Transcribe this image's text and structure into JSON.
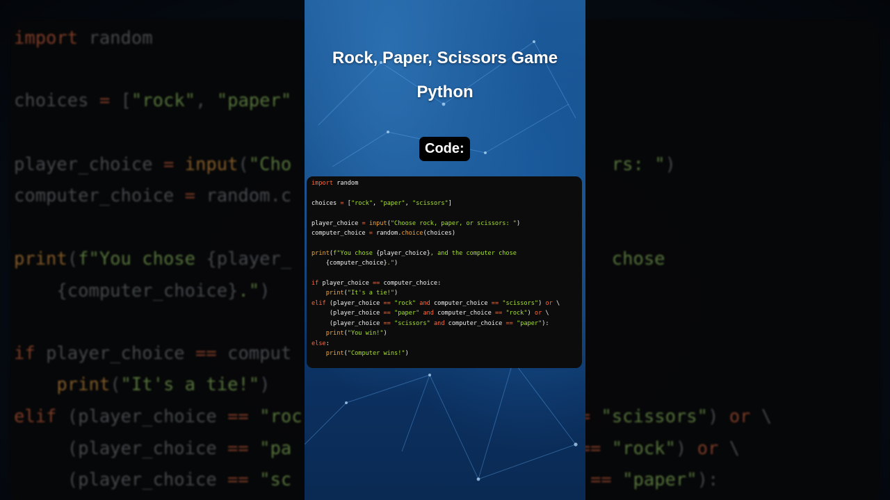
{
  "title_line1": "Rock, Paper, Scissors Game",
  "title_line2": "Python",
  "code_label": "Code:",
  "code_lines": [
    [
      {
        "t": "import",
        "c": "k"
      },
      {
        "t": " random"
      }
    ],
    [],
    [
      {
        "t": "choices "
      },
      {
        "t": "=",
        "c": "o"
      },
      {
        "t": " ["
      },
      {
        "t": "\"rock\"",
        "c": "s"
      },
      {
        "t": ", "
      },
      {
        "t": "\"paper\"",
        "c": "s"
      },
      {
        "t": ", "
      },
      {
        "t": "\"scissors\"",
        "c": "s"
      },
      {
        "t": "]"
      }
    ],
    [],
    [
      {
        "t": "player_choice "
      },
      {
        "t": "=",
        "c": "o"
      },
      {
        "t": " "
      },
      {
        "t": "input",
        "c": "f"
      },
      {
        "t": "("
      },
      {
        "t": "\"Choose rock, paper, or scissors: \"",
        "c": "s"
      },
      {
        "t": ")"
      }
    ],
    [
      {
        "t": "computer_choice "
      },
      {
        "t": "=",
        "c": "o"
      },
      {
        "t": " random."
      },
      {
        "t": "choice",
        "c": "f"
      },
      {
        "t": "(choices)"
      }
    ],
    [],
    [
      {
        "t": "print",
        "c": "f"
      },
      {
        "t": "("
      },
      {
        "t": "f\"You chose ",
        "c": "s"
      },
      {
        "t": "{player_choice}"
      },
      {
        "t": ", and the computer chose",
        "c": "s"
      }
    ],
    [
      {
        "t": "    {computer_choice}"
      },
      {
        "t": ".\"",
        "c": "s"
      },
      {
        "t": ")"
      }
    ],
    [],
    [
      {
        "t": "if",
        "c": "k"
      },
      {
        "t": " player_choice "
      },
      {
        "t": "==",
        "c": "o"
      },
      {
        "t": " computer_choice:"
      }
    ],
    [
      {
        "t": "    "
      },
      {
        "t": "print",
        "c": "f"
      },
      {
        "t": "("
      },
      {
        "t": "\"It's a tie!\"",
        "c": "s"
      },
      {
        "t": ")"
      }
    ],
    [
      {
        "t": "elif",
        "c": "k"
      },
      {
        "t": " (player_choice "
      },
      {
        "t": "==",
        "c": "o"
      },
      {
        "t": " "
      },
      {
        "t": "\"rock\"",
        "c": "s"
      },
      {
        "t": " "
      },
      {
        "t": "and",
        "c": "k"
      },
      {
        "t": " computer_choice "
      },
      {
        "t": "==",
        "c": "o"
      },
      {
        "t": " "
      },
      {
        "t": "\"scissors\"",
        "c": "s"
      },
      {
        "t": ") "
      },
      {
        "t": "or",
        "c": "k"
      },
      {
        "t": " \\"
      }
    ],
    [
      {
        "t": "     (player_choice "
      },
      {
        "t": "==",
        "c": "o"
      },
      {
        "t": " "
      },
      {
        "t": "\"paper\"",
        "c": "s"
      },
      {
        "t": " "
      },
      {
        "t": "and",
        "c": "k"
      },
      {
        "t": " computer_choice "
      },
      {
        "t": "==",
        "c": "o"
      },
      {
        "t": " "
      },
      {
        "t": "\"rock\"",
        "c": "s"
      },
      {
        "t": ") "
      },
      {
        "t": "or",
        "c": "k"
      },
      {
        "t": " \\"
      }
    ],
    [
      {
        "t": "     (player_choice "
      },
      {
        "t": "==",
        "c": "o"
      },
      {
        "t": " "
      },
      {
        "t": "\"scissors\"",
        "c": "s"
      },
      {
        "t": " "
      },
      {
        "t": "and",
        "c": "k"
      },
      {
        "t": " computer_choice "
      },
      {
        "t": "==",
        "c": "o"
      },
      {
        "t": " "
      },
      {
        "t": "\"paper\"",
        "c": "s"
      },
      {
        "t": "):"
      }
    ],
    [
      {
        "t": "    "
      },
      {
        "t": "print",
        "c": "f"
      },
      {
        "t": "("
      },
      {
        "t": "\"You win!\"",
        "c": "s"
      },
      {
        "t": ")"
      }
    ],
    [
      {
        "t": "else",
        "c": "k"
      },
      {
        "t": ":"
      }
    ],
    [
      {
        "t": "    "
      },
      {
        "t": "print",
        "c": "f"
      },
      {
        "t": "("
      },
      {
        "t": "\"Computer wins!\"",
        "c": "s"
      },
      {
        "t": ")"
      }
    ]
  ],
  "bg_lines": [
    [
      {
        "t": "import",
        "c": "bk"
      },
      {
        "t": " random"
      }
    ],
    [
      {
        "t": "choices "
      },
      {
        "t": "=",
        "c": "bk"
      },
      {
        "t": " ["
      },
      {
        "t": "\"rock\"",
        "c": "bs"
      },
      {
        "t": ", "
      },
      {
        "t": "\"paper\"",
        "c": "bs"
      },
      {
        "t": "                             "
      }
    ],
    [
      {
        "t": "player_choice "
      },
      {
        "t": "=",
        "c": "bk"
      },
      {
        "t": " "
      },
      {
        "t": "input",
        "c": "bf"
      },
      {
        "t": "("
      },
      {
        "t": "\"Cho",
        "c": "bs"
      },
      {
        "t": "                              "
      },
      {
        "t": "rs: \"",
        "c": "bs"
      },
      {
        "t": ")"
      }
    ],
    [
      {
        "t": "computer_choice "
      },
      {
        "t": "=",
        "c": "bk"
      },
      {
        "t": " random.c"
      }
    ],
    [
      {
        "t": "print",
        "c": "bf"
      },
      {
        "t": "("
      },
      {
        "t": "f\"You chose ",
        "c": "bs"
      },
      {
        "t": "{player_"
      },
      {
        "t": "                              "
      },
      {
        "t": "chose",
        "c": "bs"
      }
    ],
    [
      {
        "t": "    {computer_choice}"
      },
      {
        "t": ".\"",
        "c": "bs"
      },
      {
        "t": ")"
      }
    ],
    [
      {
        "t": "if",
        "c": "bk"
      },
      {
        "t": " player_choice "
      },
      {
        "t": "==",
        "c": "bk"
      },
      {
        "t": " comput"
      }
    ],
    [
      {
        "t": "    "
      },
      {
        "t": "print",
        "c": "bf"
      },
      {
        "t": "("
      },
      {
        "t": "\"It's a tie!\"",
        "c": "bs"
      },
      {
        "t": ")"
      }
    ],
    [
      {
        "t": "elif",
        "c": "bk"
      },
      {
        "t": " (player_choice "
      },
      {
        "t": "==",
        "c": "bk"
      },
      {
        "t": " "
      },
      {
        "t": "\"roc",
        "c": "bs"
      },
      {
        "t": "                          "
      },
      {
        "t": "= ",
        "c": "bk"
      },
      {
        "t": "\"scissors\"",
        "c": "bs"
      },
      {
        "t": ") "
      },
      {
        "t": "or",
        "c": "bk"
      },
      {
        "t": " \\"
      }
    ],
    [
      {
        "t": "     (player_choice "
      },
      {
        "t": "==",
        "c": "bk"
      },
      {
        "t": " "
      },
      {
        "t": "\"pa",
        "c": "bs"
      },
      {
        "t": "                           "
      },
      {
        "t": "== ",
        "c": "bk"
      },
      {
        "t": "\"rock\"",
        "c": "bs"
      },
      {
        "t": ") "
      },
      {
        "t": "or",
        "c": "bk"
      },
      {
        "t": " \\"
      }
    ],
    [
      {
        "t": "     (player_choice "
      },
      {
        "t": "==",
        "c": "bk"
      },
      {
        "t": " "
      },
      {
        "t": "\"sc",
        "c": "bs"
      },
      {
        "t": "                          "
      },
      {
        "t": "e == ",
        "c": "bk"
      },
      {
        "t": "\"paper\"",
        "c": "bs"
      },
      {
        "t": "):"
      }
    ]
  ]
}
